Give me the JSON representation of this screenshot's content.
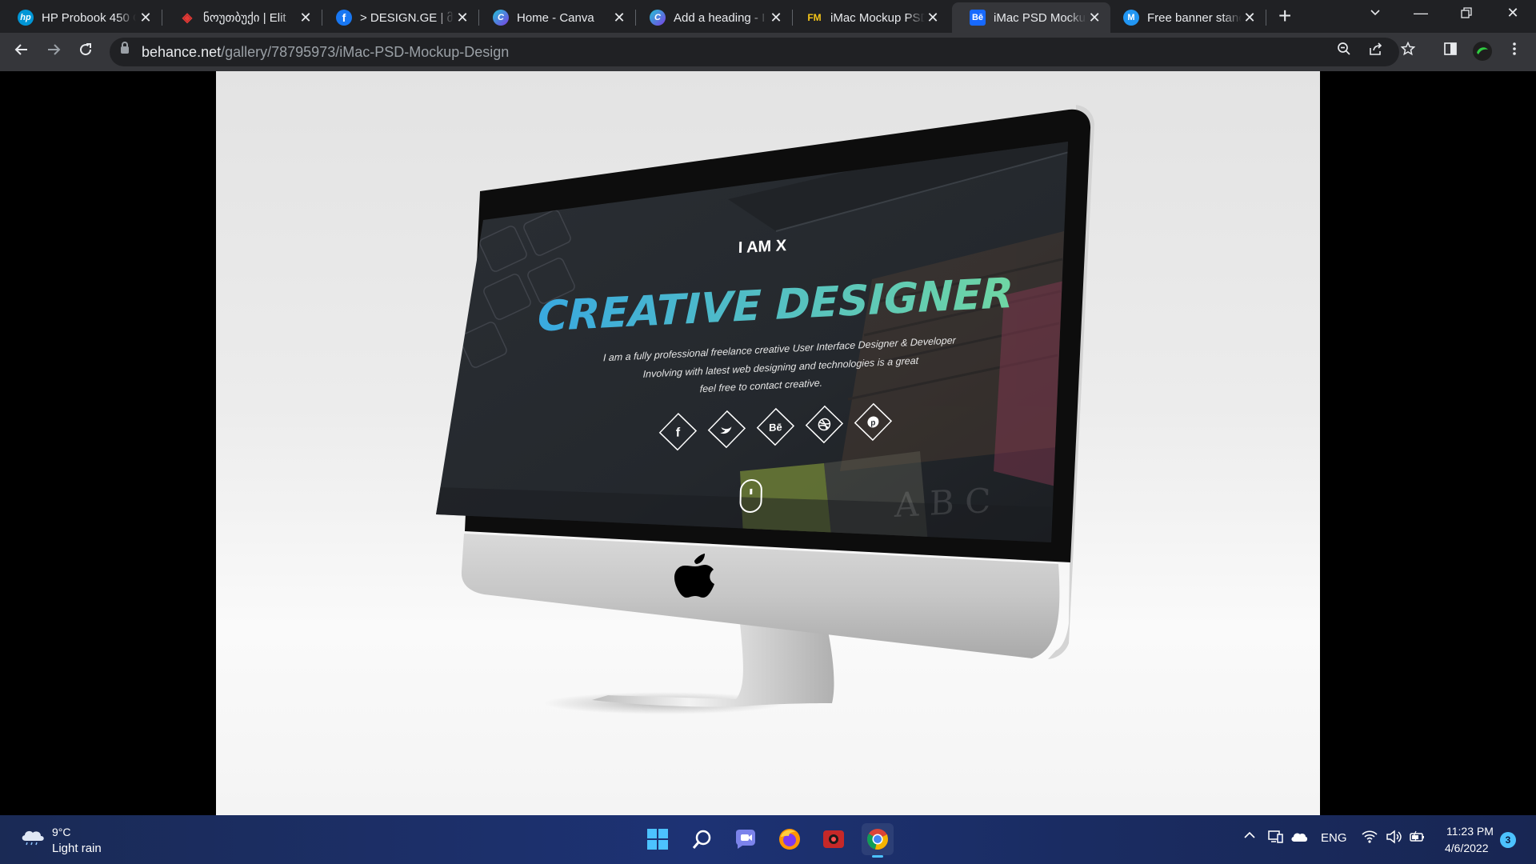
{
  "tabs": [
    {
      "title": "HP Probook 450 G",
      "favicon": "hp-icon",
      "fav_color": "#0096d6",
      "fav_text": "hp"
    },
    {
      "title": "ნოუთბუქი | Elit",
      "favicon": "elit-icon",
      "fav_color": "#c2185b",
      "fav_text": "◈"
    },
    {
      "title": "> DESIGN.GE | მ",
      "favicon": "facebook-icon",
      "fav_color": "#1877f2",
      "fav_text": "f"
    },
    {
      "title": "Home - Canva",
      "favicon": "canva-icon",
      "fav_color": "#2bb0d6",
      "fav_text": "C"
    },
    {
      "title": "Add a heading - I",
      "favicon": "canva-icon",
      "fav_color": "#2bb0d6",
      "fav_text": "C"
    },
    {
      "title": "iMac Mockup PSD",
      "favicon": "freemockup-icon",
      "fav_color": "#202124",
      "fav_text": "FM"
    },
    {
      "title": "iMac PSD Mockup",
      "favicon": "behance-icon",
      "fav_color": "#1769ff",
      "fav_text": "Bē"
    },
    {
      "title": "Free banner stanc",
      "favicon": "mockup-icon",
      "fav_color": "#2196f3",
      "fav_text": "M"
    }
  ],
  "active_tab_index": 6,
  "address_bar": {
    "host": "behance.net",
    "path": "/gallery/78795973/iMac-PSD-Mockup-Design"
  },
  "mockup_screen": {
    "kicker": "I AM X",
    "headline": "CREATIVE DESIGNER",
    "line1": "I am a fully professional freelance creative User Interface Designer & Developer",
    "line2": "Involving with latest web designing and technologies is a great",
    "line3": "feel free to contact creative.",
    "socials": [
      "facebook-icon",
      "twitter-icon",
      "behance-icon",
      "dribbble-icon",
      "pinterest-icon"
    ],
    "behance_label": "Bē",
    "deco_letters": "A B C"
  },
  "taskbar": {
    "temperature": "9°C",
    "weather": "Light rain",
    "language": "ENG",
    "time": "11:23 PM",
    "date": "4/6/2022",
    "notifications": "3"
  },
  "colors": {
    "accent_gradient_start": "#39a9e0",
    "accent_gradient_end": "#6fd6a4",
    "chrome_dark": "#202124",
    "chrome_toolbar": "#35363a"
  }
}
